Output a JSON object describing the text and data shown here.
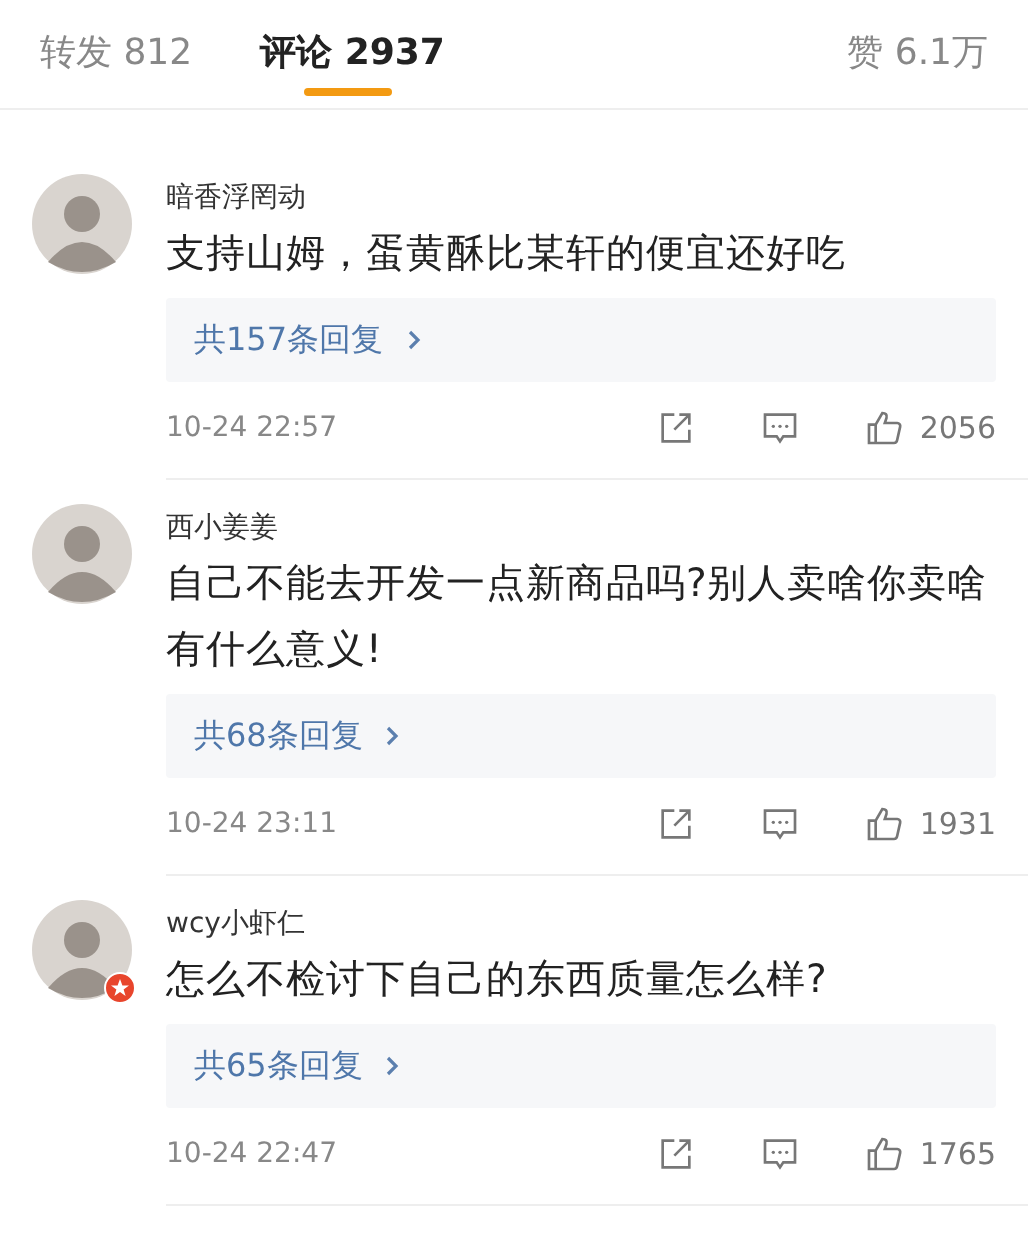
{
  "tabs": [
    {
      "label": "转发 812",
      "selected": false
    },
    {
      "label": "评论 2937",
      "selected": true
    },
    {
      "label": "赞 6.1万",
      "selected": false
    }
  ],
  "comments": [
    {
      "user": "暗香浮罔动",
      "badge": false,
      "text": "支持山姆，蛋黄酥比某轩的便宜还好吃",
      "replies": "共157条回复",
      "time": "10-24 22:57",
      "likes": "2056"
    },
    {
      "user": "西小姜姜",
      "badge": false,
      "text": "自己不能去开发一点新商品吗?别人卖啥你卖啥有什么意义!",
      "replies": "共68条回复",
      "time": "10-24 23:11",
      "likes": "1931"
    },
    {
      "user": "wcy小虾仁",
      "badge": true,
      "text": "怎么不检讨下自己的东西质量怎么样?",
      "replies": "共65条回复",
      "time": "10-24 22:47",
      "likes": "1765"
    }
  ]
}
